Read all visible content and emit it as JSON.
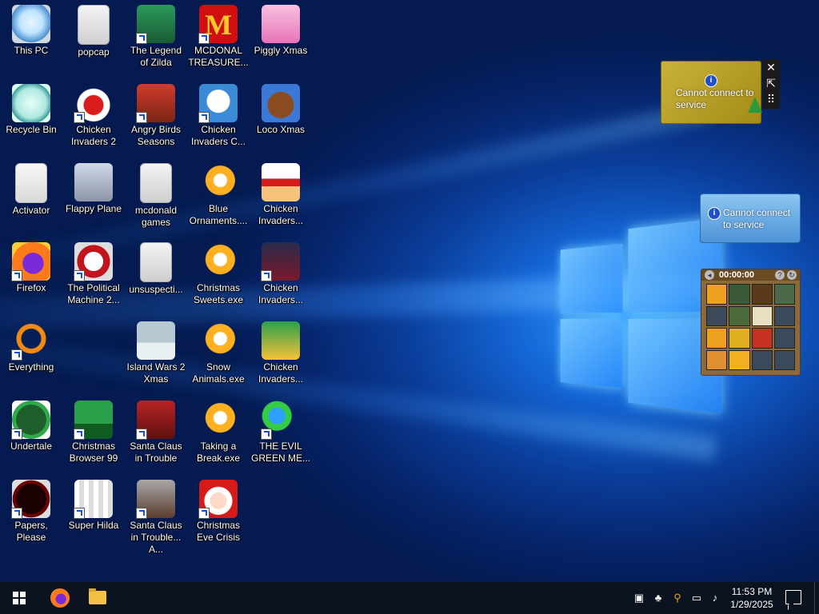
{
  "desktop": {
    "icons": [
      {
        "label": "This PC",
        "icon": "computer-icon",
        "shortcut": false
      },
      {
        "label": "Recycle Bin",
        "icon": "recycle-bin-icon",
        "shortcut": false
      },
      {
        "label": "Activator",
        "icon": "folder-icon",
        "shortcut": false
      },
      {
        "label": "Firefox",
        "icon": "firefox-icon",
        "shortcut": true
      },
      {
        "label": "Everything",
        "icon": "everything-search-icon",
        "shortcut": true
      },
      {
        "label": "Undertale",
        "icon": "undertale-icon",
        "shortcut": true
      },
      {
        "label": "Papers, Please",
        "icon": "papers-please-icon",
        "shortcut": true
      },
      {
        "label": "popcap",
        "icon": "folder-icon",
        "shortcut": false
      },
      {
        "label": "Chicken Invaders 2",
        "icon": "chicken-invaders-icon",
        "shortcut": true
      },
      {
        "label": "Flappy Plane",
        "icon": "flappy-plane-icon",
        "shortcut": false
      },
      {
        "label": "The Political Machine 2...",
        "icon": "political-machine-icon",
        "shortcut": true
      },
      {
        "label": "Christmas Browser 99",
        "icon": "christmas-tree-icon",
        "shortcut": true
      },
      {
        "label": "Super Hilda",
        "icon": "super-hilda-icon",
        "shortcut": true
      },
      {
        "label": "The Legend of Zilda",
        "icon": "zilda-icon",
        "shortcut": true
      },
      {
        "label": "Angry Birds Seasons",
        "icon": "angry-birds-icon",
        "shortcut": true
      },
      {
        "label": "mcdonald games",
        "icon": "folder-icon",
        "shortcut": false
      },
      {
        "label": "unsuspecti...",
        "icon": "folder-icon",
        "shortcut": false
      },
      {
        "label": "Island Wars 2 Xmas",
        "icon": "island-wars-icon",
        "shortcut": false
      },
      {
        "label": "Santa Claus in Trouble",
        "icon": "santa-icon",
        "shortcut": true
      },
      {
        "label": "Santa Claus in Trouble... A...",
        "icon": "santa-icon",
        "shortcut": true
      },
      {
        "label": "MCDONAL TREASURE...",
        "icon": "mcdonalds-icon",
        "shortcut": true
      },
      {
        "label": "Chicken Invaders C...",
        "icon": "snowman-icon",
        "shortcut": true
      },
      {
        "label": "Blue Ornaments....",
        "icon": "xmas-game-icon",
        "shortcut": false
      },
      {
        "label": "Christmas Sweets.exe",
        "icon": "xmas-game-icon",
        "shortcut": false
      },
      {
        "label": "Snow Animals.exe",
        "icon": "xmas-game-icon",
        "shortcut": false
      },
      {
        "label": "Taking a Break.exe",
        "icon": "xmas-game-icon",
        "shortcut": false
      },
      {
        "label": "Christmas Eve Crisis",
        "icon": "santa-icon",
        "shortcut": true
      },
      {
        "label": "Piggly Xmas",
        "icon": "piggy-icon",
        "shortcut": false
      },
      {
        "label": "Loco Xmas",
        "icon": "teddy-bear-icon",
        "shortcut": false
      },
      {
        "label": "Chicken Invaders...",
        "icon": "chicken-invaders-icon",
        "shortcut": false
      },
      {
        "label": "Chicken Invaders...",
        "icon": "chicken-invaders-icon",
        "shortcut": true
      },
      {
        "label": "Chicken Invaders...",
        "icon": "chicken-invaders-icon",
        "shortcut": false
      },
      {
        "label": "THE EVIL GREEN ME...",
        "icon": "messenger-icon",
        "shortcut": true
      }
    ]
  },
  "widgets": {
    "gold_message": "Cannot connect to service",
    "blue_message": "Cannot connect to service",
    "info_glyph": "i",
    "tools": {
      "close": "✕",
      "resize": "⇱",
      "drag": "⠿"
    },
    "puzzle": {
      "timer": "00:00:00",
      "help": "?",
      "refresh": "↻",
      "back": "◂"
    }
  },
  "taskbar": {
    "time": "11:53 PM",
    "date": "1/29/2025",
    "pinned": [
      "firefox-icon",
      "file-explorer-icon"
    ],
    "tray": [
      "security-icon",
      "network-people-icon",
      "search-tool-icon",
      "network-icon",
      "volume-icon"
    ]
  },
  "colors": {
    "taskbar": "#0b1320",
    "wallpaper": "#0a3d9a",
    "label_text": "#ffffff"
  }
}
